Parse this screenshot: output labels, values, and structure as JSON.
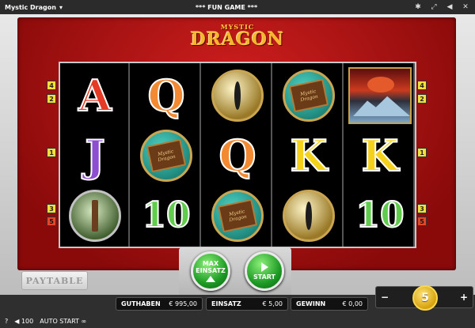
{
  "topbar": {
    "game_title": "Mystic Dragon",
    "center_label": "*** FUN GAME ***",
    "icons": [
      "settings-icon",
      "fullscreen-icon",
      "sound-icon",
      "close-icon"
    ]
  },
  "logo": {
    "line1": "MYSTIC",
    "line2": "DRAGON"
  },
  "reels": [
    [
      {
        "type": "letter",
        "value": "A",
        "cls": "A"
      },
      {
        "type": "letter",
        "value": "J",
        "cls": "J"
      },
      {
        "type": "orb-tree"
      }
    ],
    [
      {
        "type": "letter",
        "value": "Q",
        "cls": "Q"
      },
      {
        "type": "orb-book"
      },
      {
        "type": "letter",
        "value": "10",
        "cls": "ten"
      }
    ],
    [
      {
        "type": "orb-eye"
      },
      {
        "type": "letter",
        "value": "Q",
        "cls": "Q"
      },
      {
        "type": "orb-book"
      }
    ],
    [
      {
        "type": "orb-book"
      },
      {
        "type": "letter",
        "value": "K",
        "cls": "K"
      },
      {
        "type": "orb-eye"
      }
    ],
    [
      {
        "type": "volcano"
      },
      {
        "type": "letter",
        "value": "K",
        "cls": "K"
      },
      {
        "type": "letter",
        "value": "10",
        "cls": "ten"
      }
    ]
  ],
  "book_text": "Mystic Dragon",
  "line_markers": {
    "left": [
      "4",
      "2",
      "1",
      "3",
      "5"
    ],
    "right": [
      "4",
      "2",
      "1",
      "3",
      "5"
    ]
  },
  "paytable_label": "PAYTABLE",
  "buttons": {
    "max_label_1": "MAX",
    "max_label_2": "EINSATZ",
    "start_label": "START"
  },
  "status": {
    "guthaben_label": "GUTHABEN",
    "guthaben_value": "€ 995,00",
    "einsatz_label": "EINSATZ",
    "einsatz_value": "€ 5,00",
    "gewinn_label": "GEWINN",
    "gewinn_value": "€ 0,00"
  },
  "stake": {
    "minus": "−",
    "plus": "+",
    "value": "5"
  },
  "footer": {
    "help": "?",
    "autostart_count": "100",
    "autostart_label": "AUTO START",
    "autostart_symbol": "∞"
  },
  "colors": {
    "panel_red": "#c8151a",
    "start_green": "#1d9b24",
    "coin_gold": "#d6a10c",
    "marker_yellow": "#f1e13a"
  }
}
